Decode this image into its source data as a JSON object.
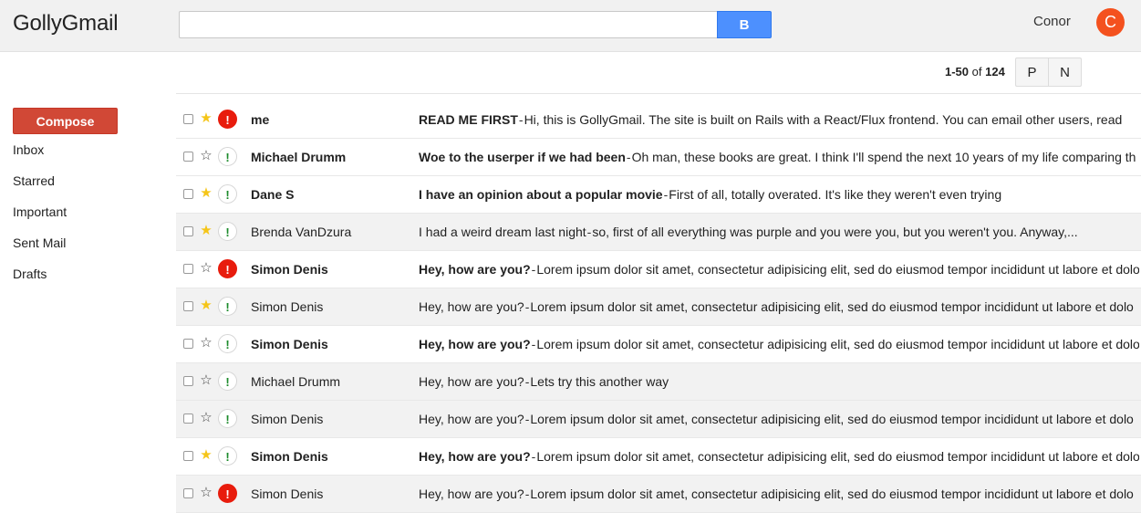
{
  "app": {
    "title": "GollyGmail"
  },
  "search": {
    "value": "",
    "placeholder": "",
    "button_label": "B"
  },
  "user": {
    "name": "Conor",
    "initial": "C"
  },
  "pager": {
    "range": "1-50",
    "of": "of",
    "total": "124",
    "prev_label": "P",
    "next_label": "N"
  },
  "sidebar": {
    "compose_label": "Compose",
    "items": [
      {
        "label": "Inbox"
      },
      {
        "label": "Starred"
      },
      {
        "label": "Important"
      },
      {
        "label": "Sent Mail"
      },
      {
        "label": "Drafts"
      }
    ]
  },
  "emails": [
    {
      "sender": "me",
      "subject": "READ ME FIRST",
      "body": "Hi, this is GollyGmail. The site is built on Rails with a React/Flux frontend. You can email other users, read",
      "starred": true,
      "important": true,
      "unread": true
    },
    {
      "sender": "Michael Drumm",
      "subject": "Woe to the userper if we had been",
      "body": "Oh man, these books are great. I think I'll spend the next 10 years of my life comparing th",
      "starred": false,
      "important": false,
      "unread": true
    },
    {
      "sender": "Dane S",
      "subject": "I have an opinion about a popular movie",
      "body": "First of all, totally overated. It's like they weren't even trying",
      "starred": true,
      "important": false,
      "unread": true
    },
    {
      "sender": "Brenda VanDzura",
      "subject": "I had a weird dream last night",
      "body": "so, first of all everything was purple and you were you, but you weren't you. Anyway,...",
      "starred": true,
      "important": false,
      "unread": false
    },
    {
      "sender": "Simon Denis",
      "subject": "Hey, how are you?",
      "body": "Lorem ipsum dolor sit amet, consectetur adipisicing elit, sed do eiusmod tempor incididunt ut labore et dolo",
      "starred": false,
      "important": true,
      "unread": true
    },
    {
      "sender": "Simon Denis",
      "subject": "Hey, how are you?",
      "body": "Lorem ipsum dolor sit amet, consectetur adipisicing elit, sed do eiusmod tempor incididunt ut labore et dolo",
      "starred": true,
      "important": false,
      "unread": false
    },
    {
      "sender": "Simon Denis",
      "subject": "Hey, how are you?",
      "body": "Lorem ipsum dolor sit amet, consectetur adipisicing elit, sed do eiusmod tempor incididunt ut labore et dolo",
      "starred": false,
      "important": false,
      "unread": true
    },
    {
      "sender": "Michael Drumm",
      "subject": "Hey, how are you?",
      "body": "Lets try this another way",
      "starred": false,
      "important": false,
      "unread": false
    },
    {
      "sender": "Simon Denis",
      "subject": "Hey, how are you?",
      "body": "Lorem ipsum dolor sit amet, consectetur adipisicing elit, sed do eiusmod tempor incididunt ut labore et dolo",
      "starred": false,
      "important": false,
      "unread": false
    },
    {
      "sender": "Simon Denis",
      "subject": "Hey, how are you?",
      "body": "Lorem ipsum dolor sit amet, consectetur adipisicing elit, sed do eiusmod tempor incididunt ut labore et dolo",
      "starred": true,
      "important": false,
      "unread": true
    },
    {
      "sender": "Simon Denis",
      "subject": "Hey, how are you?",
      "body": "Lorem ipsum dolor sit amet, consectetur adipisicing elit, sed do eiusmod tempor incididunt ut labore et dolo",
      "starred": false,
      "important": true,
      "unread": false
    }
  ],
  "icons": {
    "star_on": "star-filled-icon",
    "star_off": "star-outline-icon",
    "important": "important-icon"
  },
  "colors": {
    "compose": "#d14836",
    "search_button": "#4d90fe",
    "avatar": "#f4511e",
    "star": "#f5c518",
    "important_on": "#e81c0d",
    "important_off": "#1b8a2a"
  }
}
